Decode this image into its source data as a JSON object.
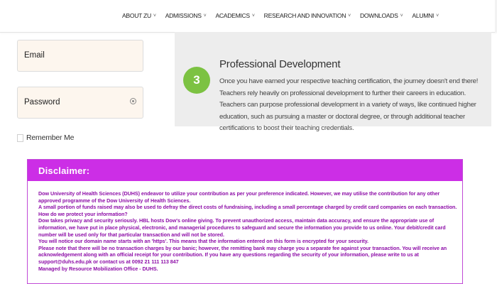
{
  "nav": {
    "items": [
      {
        "label": "ABOUT ZU",
        "caret": "˅"
      },
      {
        "label": "ADMISSIONS",
        "caret": "˅"
      },
      {
        "label": "ACADEMICS",
        "caret": "˅"
      },
      {
        "label": "RESEARCH AND INNOVATION",
        "caret": "˅"
      },
      {
        "label": "DOWNLOADS",
        "caret": "˅"
      },
      {
        "label": "ALUMNI",
        "caret": "˅"
      }
    ]
  },
  "login": {
    "email_label": "Email",
    "password_label": "Password",
    "password_icon": "eye-icon",
    "remember_label": "Remember Me"
  },
  "professional_development": {
    "step": "3",
    "title": "Professional Development",
    "body": "Once you have earned your respective teaching certification, the journey doesn't end there! Teachers rely heavily on professional development to further their careers in education. Teachers can purpose professional development in a variety of ways, like continued higher education, such as pursuing a master or doctoral degree, or through additional teacher certifications to boost their teaching credentials."
  },
  "disclaimer": {
    "title": "Disclaimer:",
    "paragraphs": [
      "Dow University of Health Sciences (DUHS) endeavor to utilize your contribution as per your preference indicated. However, we may utilise the contribution for any other approved programme of the Dow University of Health Sciences.",
      "A small portion of funds raised may also be used to defray the direct costs of fundraising, including a small percentage charged by credit card companies on each transaction.",
      "How do we protect your information?",
      "Dow takes privacy and security seriously. HBL hosts Dow's online giving. To prevent unauthorized access, maintain data accuracy, and ensure the appropriate use of information, we have put in place physical, electronic, and managerial procedures to safeguard and secure the information you provide to us online. Your debit/credit card number will be used only for that particular transaction and will not be stored.",
      "You will notice our domain name starts with an 'https'. This means that the information entered on this form is encrypted for your security.",
      "Please note that there will be no transaction charges by our banic; however, the remitting bank may charge you a separate fee against your transaction. You will receive an acknowledgement along with an official receipt for your contribution. If you have any questions regarding the security of your information, please write to us at support@duhs.edu.pk or contact us at 0092 21 111 113 847",
      "Managed by Resource Mobilization Office - DUHS."
    ]
  },
  "colors": {
    "step_green": "#7cc242",
    "disclaimer_header": "#cc2ee6",
    "disclaimer_text": "#8e0fa8",
    "card_bg": "#ededed",
    "field_bg": "#fdf6ee"
  }
}
